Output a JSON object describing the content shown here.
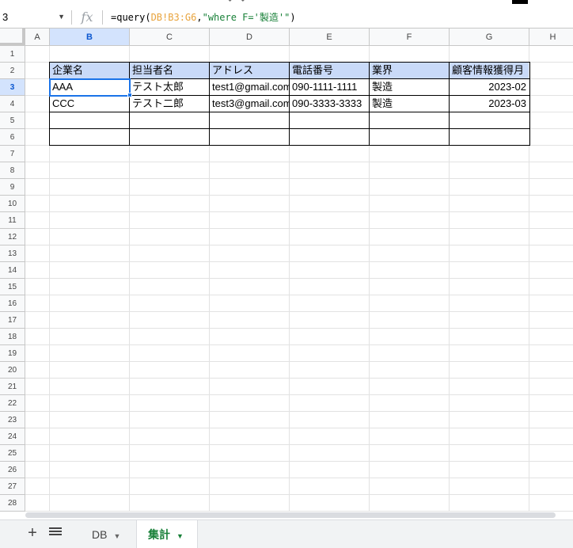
{
  "formula_bar": {
    "name_box": "3",
    "fx": "fx",
    "formula_prefix": "=query(",
    "formula_ref": "DB!B3:G6",
    "formula_mid": ",",
    "formula_string": "\"where F='製造'\"",
    "formula_suffix": ")"
  },
  "columns": [
    "A",
    "B",
    "C",
    "D",
    "E",
    "F",
    "G",
    "H"
  ],
  "rows": [
    "1",
    "2",
    "3",
    "4",
    "5",
    "6",
    "7",
    "8",
    "9",
    "10",
    "11",
    "12",
    "13",
    "14",
    "15",
    "16",
    "17",
    "18",
    "19",
    "20",
    "21",
    "22",
    "23",
    "24",
    "25",
    "26",
    "27",
    "28"
  ],
  "table": {
    "headers": [
      "企業名",
      "担当者名",
      "アドレス",
      "電話番号",
      "業界",
      "顧客情報獲得月"
    ],
    "data": [
      [
        "AAA",
        "テスト太郎",
        "test1@gmail.com",
        "090-1111-1111",
        "製造",
        "2023-02"
      ],
      [
        "CCC",
        "テスト二郎",
        "test3@gmail.com",
        "090-3333-3333",
        "製造",
        "2023-03"
      ]
    ]
  },
  "sheet_tabs": {
    "add": "+",
    "tabs": [
      {
        "label": "DB"
      },
      {
        "label": "集計"
      }
    ]
  },
  "colors": {
    "header_fill": "#c9daf8",
    "selection": "#1a73e8",
    "active_tab": "#188038"
  }
}
